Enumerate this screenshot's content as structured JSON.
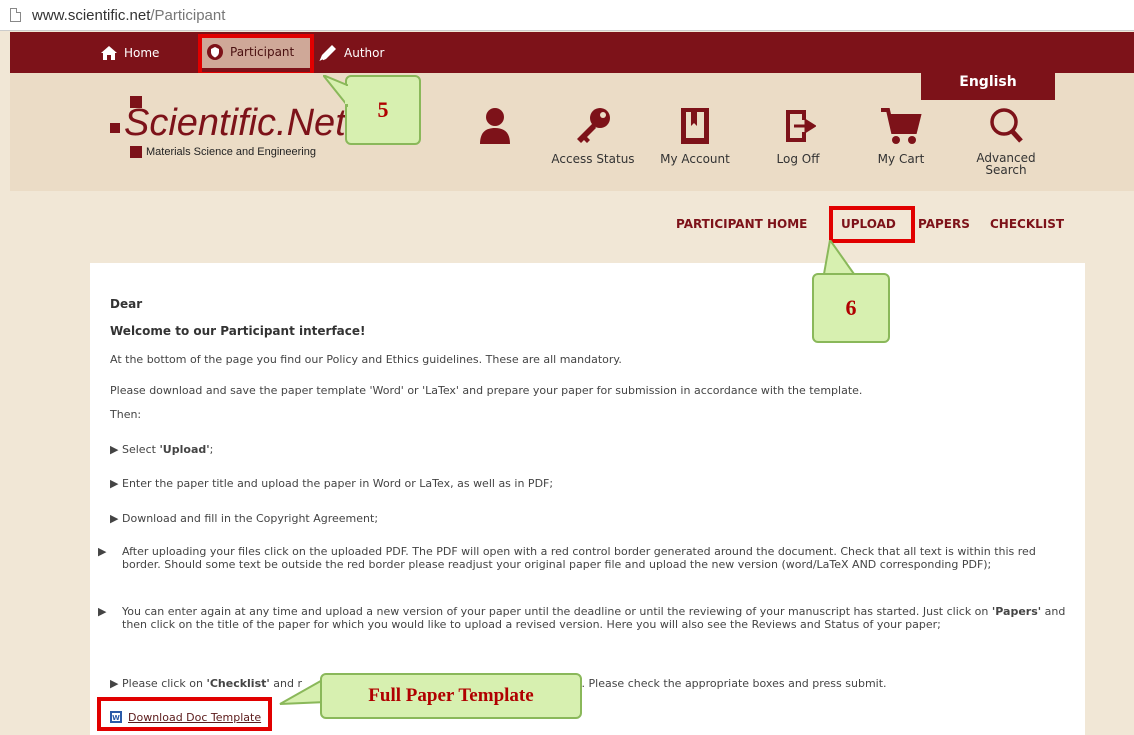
{
  "browser": {
    "url_host": "www.scientific.net",
    "url_path": "/Participant"
  },
  "topnav": {
    "home": "Home",
    "participant": "Participant",
    "author": "Author"
  },
  "language": "English",
  "logo": {
    "name": "Scientific.Net",
    "subtitle": "Materials Science and Engineering"
  },
  "header_icons": [
    {
      "label": "",
      "icon": "user-icon"
    },
    {
      "label": "Access Status",
      "icon": "key-icon"
    },
    {
      "label": "My Account",
      "icon": "book-icon"
    },
    {
      "label": "Log Off",
      "icon": "logoff-icon"
    },
    {
      "label": "My Cart",
      "icon": "cart-icon"
    },
    {
      "label": "Advanced Search",
      "icon": "search-icon"
    }
  ],
  "subnav": {
    "home": "PARTICIPANT HOME",
    "upload": "UPLOAD",
    "papers": "PAPERS",
    "checklist": "CHECKLIST"
  },
  "callouts": {
    "c5": "5",
    "c6": "6",
    "template": "Full Paper Template"
  },
  "content": {
    "dear": "Dear",
    "welcome": "Welcome to our Participant interface!",
    "line1": "At the bottom of the page you find our Policy and Ethics guidelines. These are all mandatory.",
    "line2": "Please download and save the paper template 'Word' or 'LaTex' and prepare your paper for submission in accordance with the template.",
    "then": "Then:",
    "b1_pre": "Select ",
    "b1_bold": "'Upload'",
    "b1_post": ";",
    "b2": "Enter the paper title and upload the paper in Word or LaTex, as well as in PDF;",
    "b3": "Download and fill in the Copyright Agreement;",
    "b4": "After uploading your files click on the uploaded PDF. The PDF will open with a red control border generated around the document. Check that all text is within this red border. Should some text be outside the red border please readjust your original paper file and upload the new version (word/LaTeX AND corresponding PDF);",
    "b5_pre": "You can enter again at any time and upload a new version of your paper until the deadline or until the reviewing of your manuscript has started. Just click on ",
    "b5_bold": "'Papers'",
    "b5_post": " and then click on the title of the paper for which you would like to upload a revised version. Here you will also see the Reviews and Status of your paper;",
    "b6_pre": "Please click on ",
    "b6_bold": "'Checklist'",
    "b6_mid": " and r",
    "b6_post": "steps. Please check the appropriate boxes and press submit.",
    "download": "Download Doc Template"
  },
  "colors": {
    "brand": "#7d1219",
    "highlight": "#e10000",
    "callout_bg": "#d7f0b0"
  }
}
